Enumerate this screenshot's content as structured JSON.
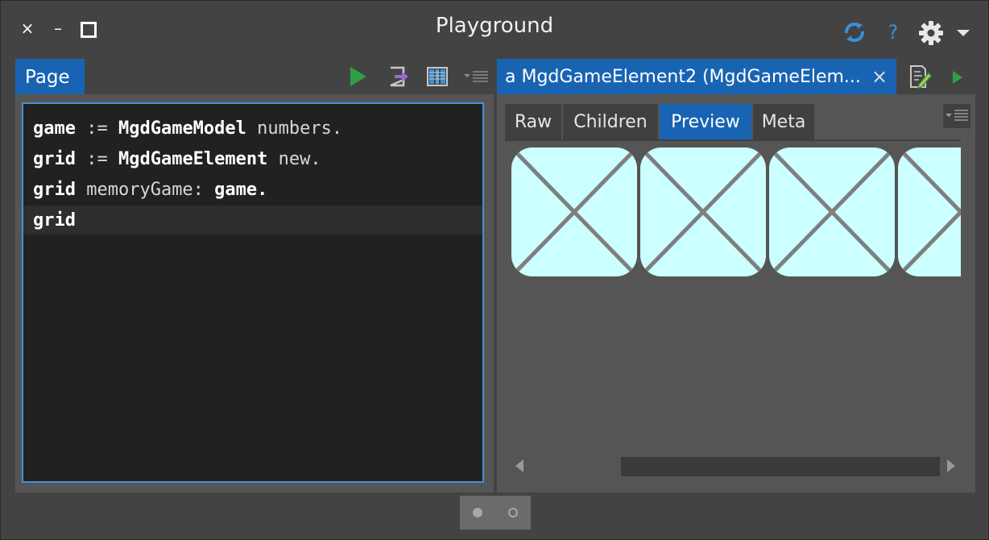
{
  "window": {
    "title": "Playground",
    "close_glyph": "×",
    "minimize_glyph": "–",
    "maximize_glyph": "□",
    "help_glyph": "?"
  },
  "colors": {
    "accent": "#1864b3",
    "run_green": "#2ea043",
    "sync_blue": "#3a8fd8",
    "preview_bg": "#ccffff",
    "cross_stroke": "#7f7f7f"
  },
  "left_pane": {
    "tab_label": "Page",
    "toolbar_icons": [
      "play-icon",
      "export-icon",
      "columns-icon",
      "pane-menu-icon"
    ],
    "code_lines": [
      {
        "parts": [
          {
            "t": "game",
            "s": "kw"
          },
          {
            "t": " := ",
            "s": "op"
          },
          {
            "t": "MgdGameModel",
            "s": "kw"
          },
          {
            "t": " numbers.",
            "s": "op"
          }
        ]
      },
      {
        "parts": [
          {
            "t": "grid",
            "s": "kw"
          },
          {
            "t": " := ",
            "s": "op"
          },
          {
            "t": "MgdGameElement",
            "s": "kw"
          },
          {
            "t": " new.",
            "s": "op"
          }
        ]
      },
      {
        "parts": [
          {
            "t": "grid",
            "s": "kw"
          },
          {
            "t": " memoryGame: ",
            "s": "op"
          },
          {
            "t": "game.",
            "s": "kw"
          }
        ]
      },
      {
        "parts": [
          {
            "t": "grid",
            "s": "kw"
          }
        ]
      }
    ]
  },
  "right_pane": {
    "tab_label": "a MgdGameElement2 (MgdGameElem...",
    "close_glyph": "×",
    "subtabs": [
      "Raw",
      "Children",
      "Preview",
      "Meta"
    ],
    "active_subtab": "Preview",
    "card_count": 4
  },
  "pager": {
    "pages": 2,
    "active_page": 1
  }
}
